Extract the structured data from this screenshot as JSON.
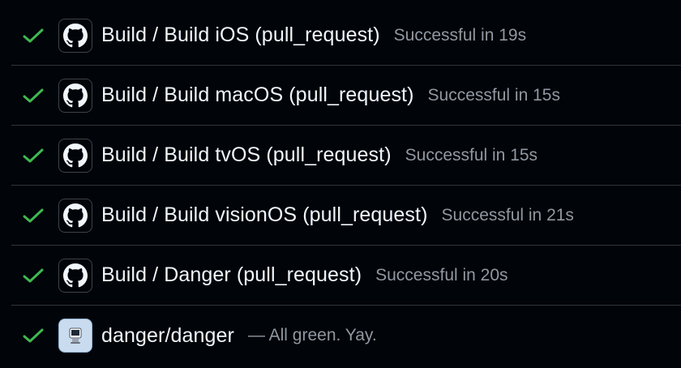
{
  "colors": {
    "background": "#010409",
    "divider": "#30363d",
    "success": "#3fb950",
    "title": "#f0f6fc",
    "muted": "#9198a1"
  },
  "checks": [
    {
      "status": "success",
      "status_icon": "check-icon",
      "avatar_icon": "github-icon",
      "name": "Build / Build iOS (pull_request)",
      "description": "Successful in 19s"
    },
    {
      "status": "success",
      "status_icon": "check-icon",
      "avatar_icon": "github-icon",
      "name": "Build / Build macOS (pull_request)",
      "description": "Successful in 15s"
    },
    {
      "status": "success",
      "status_icon": "check-icon",
      "avatar_icon": "github-icon",
      "name": "Build / Build tvOS (pull_request)",
      "description": "Successful in 15s"
    },
    {
      "status": "success",
      "status_icon": "check-icon",
      "avatar_icon": "github-icon",
      "name": "Build / Build visionOS (pull_request)",
      "description": "Successful in 21s"
    },
    {
      "status": "success",
      "status_icon": "check-icon",
      "avatar_icon": "github-icon",
      "name": "Build / Danger (pull_request)",
      "description": "Successful in 20s"
    },
    {
      "status": "success",
      "status_icon": "check-icon",
      "avatar_icon": "danger-app-icon",
      "name": "danger/danger",
      "description": "— All green. Yay."
    }
  ]
}
